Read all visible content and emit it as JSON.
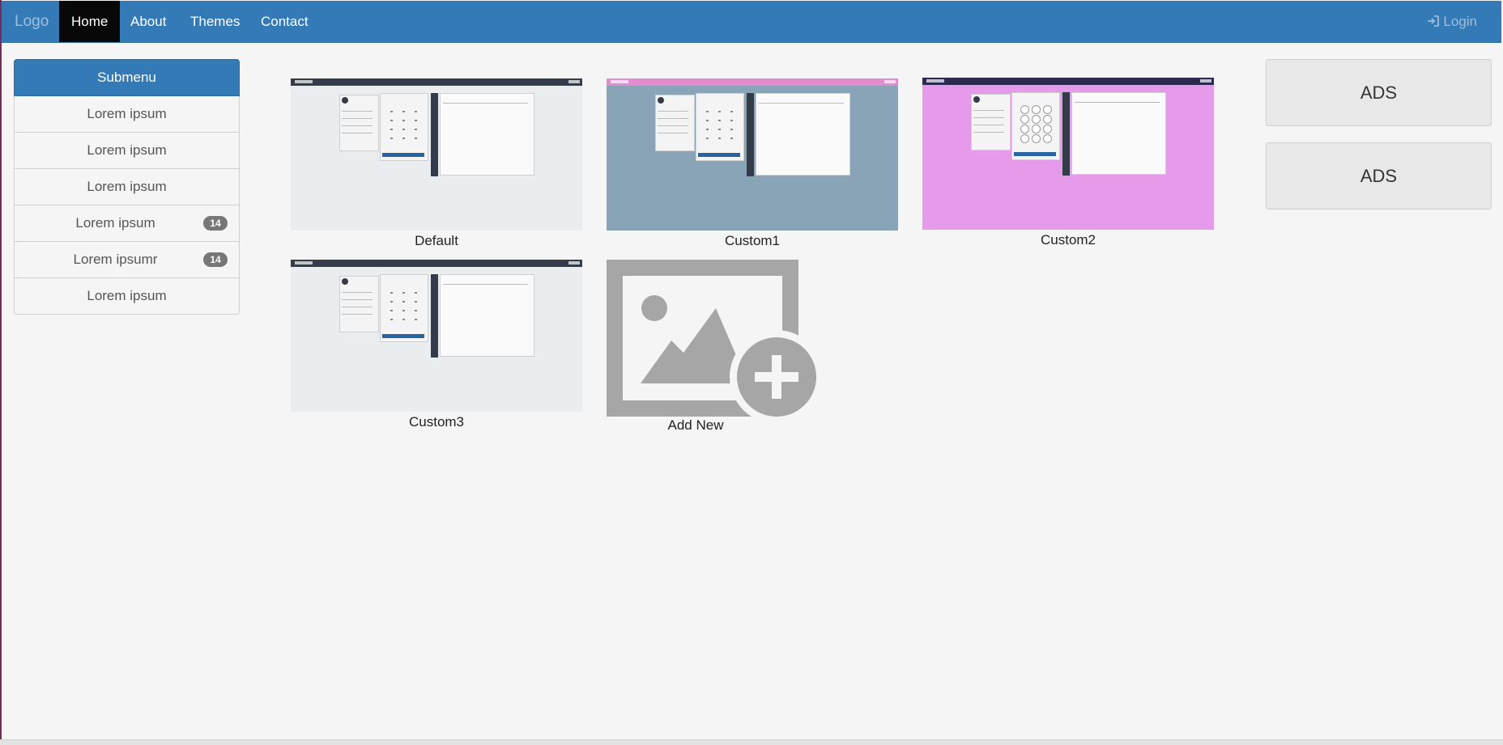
{
  "navbar": {
    "brand": "Logo",
    "items": [
      {
        "label": "Home",
        "active": true
      },
      {
        "label": "About",
        "active": false
      },
      {
        "label": "Themes",
        "active": false
      },
      {
        "label": "Contact",
        "active": false
      }
    ],
    "login_label": "Login",
    "login_icon": "sign-in-icon",
    "color": "#337ab7"
  },
  "sidebar": {
    "header": "Submenu",
    "items": [
      {
        "label": "Lorem ipsum"
      },
      {
        "label": "Lorem ipsum"
      },
      {
        "label": "Lorem ipsum"
      },
      {
        "label": "Lorem ipsum",
        "badge": "14"
      },
      {
        "label": "Lorem ipsumr",
        "badge": "14"
      },
      {
        "label": "Lorem ipsum"
      }
    ]
  },
  "themes": [
    {
      "name": "Default",
      "bg": "#e9edf0",
      "topbar": "#333c48"
    },
    {
      "name": "Custom1",
      "bg": "#8aa4b7",
      "topbar": "#e28bcf"
    },
    {
      "name": "Custom2",
      "bg": "#e59aea",
      "topbar": "#2d2a52"
    },
    {
      "name": "Custom3",
      "bg": "#e9edf0",
      "topbar": "#333c48"
    }
  ],
  "add_new": {
    "label": "Add New",
    "icon": "add-image-icon"
  },
  "ads": [
    "ADS",
    "ADS"
  ]
}
